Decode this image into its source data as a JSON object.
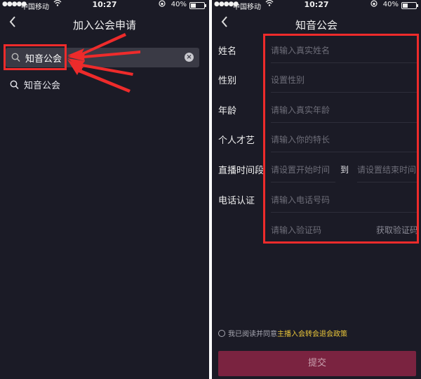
{
  "status": {
    "carrier": "中国移动",
    "time": "10:27",
    "battery": "40%",
    "battery_level": 0.4
  },
  "left": {
    "title": "加入公会申请",
    "search": {
      "value": "知音公会"
    },
    "results": [
      {
        "label": "知音公会"
      }
    ]
  },
  "right": {
    "title": "知音公会",
    "fields": {
      "name": {
        "label": "姓名",
        "placeholder": "请输入真实姓名"
      },
      "gender": {
        "label": "性别",
        "placeholder": "设置性别"
      },
      "age": {
        "label": "年龄",
        "placeholder": "请输入真实年龄"
      },
      "talent": {
        "label": "个人才艺",
        "placeholder": "请输入你的特长"
      },
      "live_time": {
        "label": "直播时间段",
        "start_placeholder": "请设置开始时间",
        "to": "到",
        "end_placeholder": "请设置结束时间"
      },
      "phone": {
        "label": "电话认证",
        "placeholder": "请输入电话号码"
      },
      "code": {
        "placeholder": "请输入验证码",
        "button": "获取验证码"
      }
    },
    "agree": {
      "text": "我已阅读并同意",
      "policy": "主播入会转会退会政策"
    },
    "submit": "提交"
  },
  "colors": {
    "background": "#1b1b26",
    "highlight": "#ee2b2b",
    "submit_bg": "#7a2340",
    "policy": "#e9c53a"
  },
  "icons": [
    "signal-dots-icon",
    "wifi-icon",
    "orientation-lock-icon",
    "battery-icon",
    "back-chevron-icon",
    "search-icon",
    "clear-icon",
    "radio-icon"
  ]
}
